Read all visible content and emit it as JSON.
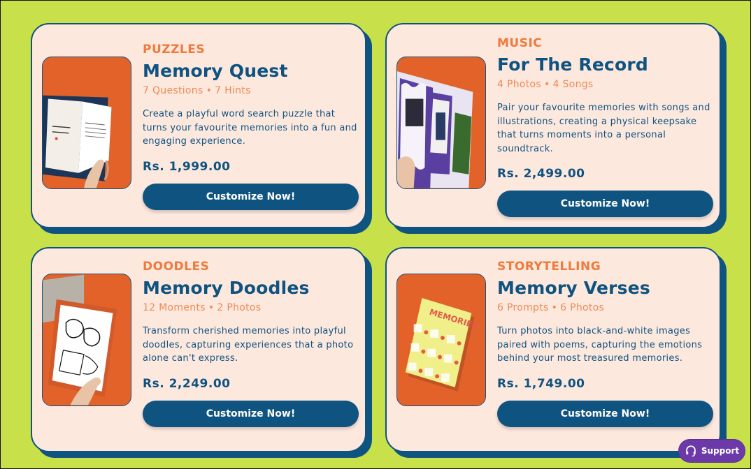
{
  "cards": [
    {
      "category": "PUZZLES",
      "title": "Memory Quest",
      "meta_a": "7 Questions",
      "meta_sep": "•",
      "meta_b": "7 Hints",
      "description": "Create a playful word search puzzle that turns your favourite memories into a fun and engaging experience.",
      "price": "Rs. 1,999.00",
      "cta": "Customize Now!",
      "image_icon": "open-book-puzzle-photo"
    },
    {
      "category": "MUSIC",
      "title": "For The Record",
      "meta_a": "4 Photos",
      "meta_sep": "•",
      "meta_b": "4 Songs",
      "description": "Pair your favourite memories with songs and illustrations, creating a physical keepsake that turns moments into a personal soundtrack.",
      "price": "Rs. 2,499.00",
      "cta": "Customize Now!",
      "image_icon": "photo-booklet-music-photo"
    },
    {
      "category": "DOODLES",
      "title": "Memory Doodles",
      "meta_a": "12 Moments",
      "meta_sep": "•",
      "meta_b": "2 Photos",
      "description": "Transform cherished memories into playful doodles, capturing experiences that a photo alone can't express.",
      "price": "Rs. 2,249.00",
      "cta": "Customize Now!",
      "image_icon": "doodle-book-photo"
    },
    {
      "category": "STORYTELLING",
      "title": "Memory Verses",
      "meta_a": "6 Prompts",
      "meta_sep": "•",
      "meta_b": "6 Photos",
      "description": "Turn photos into black-and-white images paired with poems, capturing the emotions behind your most treasured memories.",
      "price": "Rs. 1,749.00",
      "cta": "Customize Now!",
      "image_icon": "memories-book-photo"
    }
  ],
  "support": {
    "label": "Support",
    "icon": "headset-icon"
  },
  "colors": {
    "background": "#c8e04a",
    "card": "#fde8de",
    "primary": "#0f5380",
    "accent": "#ee7a3c",
    "support": "#6b3aa8"
  }
}
